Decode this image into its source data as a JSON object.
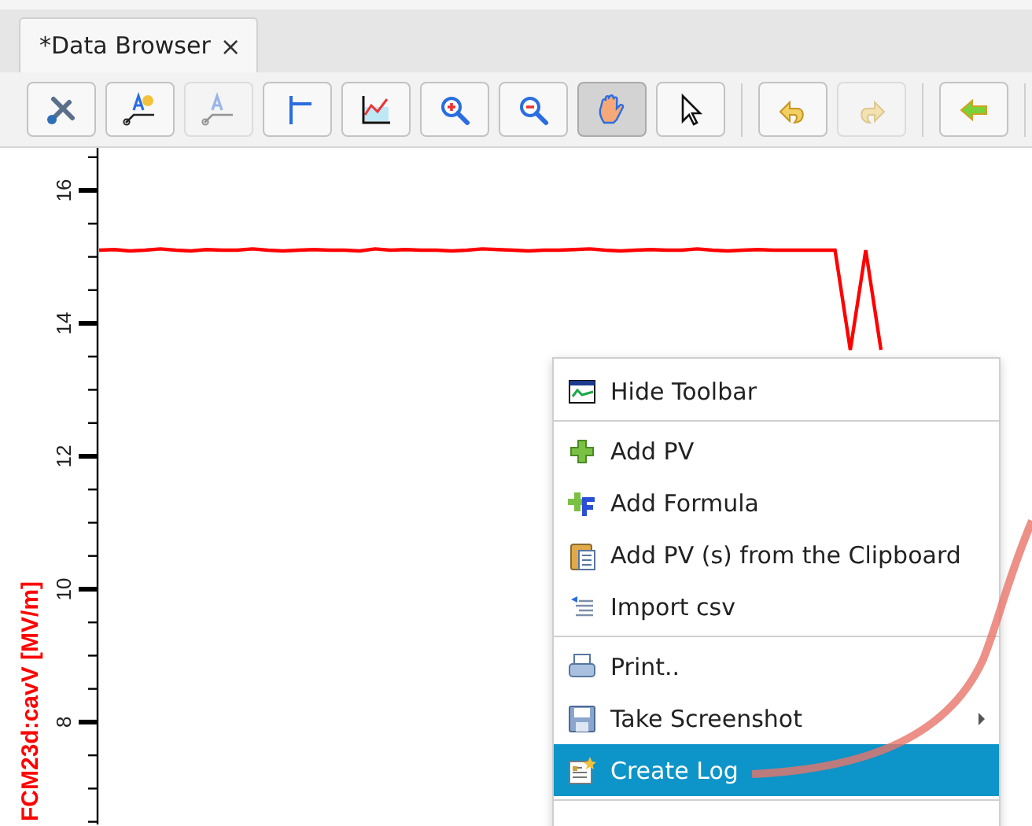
{
  "tab": {
    "title": "*Data Browser",
    "close": "×",
    "selected": true
  },
  "toolbar": {
    "groups": [
      [
        {
          "kind": "tools",
          "selected": false,
          "disabled": false
        },
        {
          "kind": "add-annotation",
          "selected": false,
          "disabled": false
        },
        {
          "kind": "annotation",
          "selected": false,
          "disabled": true
        },
        {
          "kind": "crosshair",
          "selected": false,
          "disabled": false
        },
        {
          "kind": "chart",
          "selected": false,
          "disabled": false
        },
        {
          "kind": "zoom-in",
          "selected": false,
          "disabled": false
        },
        {
          "kind": "zoom-out",
          "selected": false,
          "disabled": false
        },
        {
          "kind": "pan",
          "selected": true,
          "disabled": false
        },
        {
          "kind": "pointer",
          "selected": false,
          "disabled": false
        }
      ],
      [
        {
          "kind": "undo",
          "selected": false,
          "disabled": false
        },
        {
          "kind": "redo",
          "selected": false,
          "disabled": true
        }
      ],
      [
        {
          "kind": "back",
          "selected": false,
          "disabled": false
        }
      ]
    ]
  },
  "plot": {
    "chart_data": {
      "type": "line",
      "ylabel": "FCM23d:cavV [MV/m]",
      "ylim": [
        6.46,
        16.64
      ],
      "yticks": [
        8,
        10,
        12,
        14,
        16
      ],
      "categories": [
        null,
        null,
        null,
        null,
        null,
        null,
        null,
        null,
        null,
        null,
        null,
        null,
        null,
        null,
        null,
        null,
        null,
        null,
        null,
        null,
        null,
        null,
        null,
        null,
        null,
        null,
        null,
        null,
        null,
        null,
        null,
        null,
        null,
        null,
        null,
        null,
        null,
        null,
        null,
        null,
        null,
        null,
        null,
        null,
        null,
        null,
        null,
        null,
        null,
        null,
        null,
        null
      ],
      "series": [
        {
          "color": "#ff0000",
          "values": [
            15.1,
            15.11,
            15.09,
            15.1,
            15.12,
            15.1,
            15.09,
            15.11,
            15.1,
            15.1,
            15.12,
            15.1,
            15.09,
            15.1,
            15.11,
            15.1,
            15.1,
            15.09,
            15.12,
            15.1,
            15.11,
            15.1,
            15.1,
            15.09,
            15.1,
            15.12,
            15.11,
            15.1,
            15.09,
            15.1,
            15.1,
            15.11,
            15.12,
            15.1,
            15.09,
            15.1,
            15.11,
            15.1,
            15.1,
            15.12,
            15.1,
            15.09,
            15.1,
            15.11,
            15.1,
            15.1,
            15.1,
            15.1,
            15.1,
            13.6,
            15.1,
            13.6
          ]
        }
      ]
    }
  },
  "context_menu": {
    "groups": [
      [
        {
          "label": "Hide Toolbar",
          "kind": "toolbar",
          "selected": false,
          "submenu": false
        }
      ],
      [
        {
          "label": "Add PV",
          "kind": "add",
          "selected": false,
          "submenu": false
        },
        {
          "label": "Add Formula",
          "kind": "formula",
          "selected": false,
          "submenu": false
        },
        {
          "label": "Add PV (s) from the Clipboard",
          "kind": "clipboard",
          "selected": false,
          "submenu": false
        },
        {
          "label": "Import csv",
          "kind": "import",
          "selected": false,
          "submenu": false
        }
      ],
      [
        {
          "label": "Print..",
          "kind": "print",
          "selected": false,
          "submenu": false
        },
        {
          "label": "Take Screenshot",
          "kind": "save",
          "selected": false,
          "submenu": true
        },
        {
          "label": "Create Log",
          "kind": "log",
          "selected": true,
          "submenu": false
        }
      ]
    ]
  }
}
